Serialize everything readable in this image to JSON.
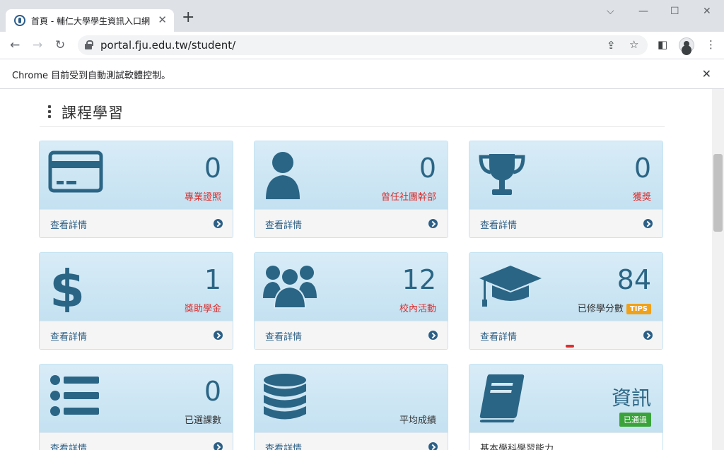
{
  "browser": {
    "tab_title": "首頁 - 輔仁大學學生資訊入口網",
    "url": "portal.fju.edu.tw/student/",
    "infobar_text": "Chrome 目前受到自動測試軟體控制。"
  },
  "section": {
    "title": "課程學習"
  },
  "details_label": "查看詳情",
  "cards": [
    {
      "icon": "credit-card-icon",
      "number": "0",
      "label": "專業證照"
    },
    {
      "icon": "user-icon",
      "number": "0",
      "label": "曾任社團幹部"
    },
    {
      "icon": "trophy-icon",
      "number": "0",
      "label": "獲獎"
    },
    {
      "icon": "dollar-icon",
      "number": "1",
      "label": "獎助學金"
    },
    {
      "icon": "users-icon",
      "number": "12",
      "label": "校內活動"
    },
    {
      "icon": "graduation-cap-icon",
      "number": "84",
      "label": "已修學分數",
      "badge": "TIPS"
    },
    {
      "icon": "list-icon",
      "number": "0",
      "label": "已選課數"
    },
    {
      "icon": "database-icon",
      "number": "",
      "label": "平均成績"
    },
    {
      "icon": "book-icon",
      "number": "資訊",
      "label": "基本學科學習能力",
      "badge": "已通過"
    }
  ],
  "colors": {
    "icon_blue": "#2b6585",
    "label_red": "#d9302f",
    "tips_orange": "#f0a11a",
    "pass_green": "#3aa33a"
  }
}
